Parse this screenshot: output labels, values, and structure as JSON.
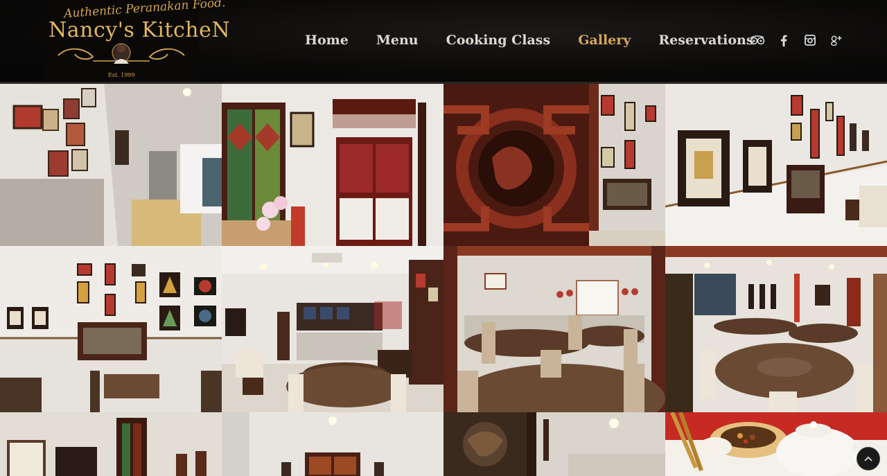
{
  "logo": {
    "tagline": "Authentic Peranakan Food.",
    "name": "Nancy's KitcheN",
    "established": "Est. 1999"
  },
  "nav": {
    "items": [
      {
        "label": "Home",
        "active": false
      },
      {
        "label": "Menu",
        "active": false
      },
      {
        "label": "Cooking Class",
        "active": false
      },
      {
        "label": "Gallery",
        "active": true
      },
      {
        "label": "Reservations",
        "active": false
      }
    ]
  },
  "social": [
    {
      "icon": "tripadvisor-icon"
    },
    {
      "icon": "facebook-icon"
    },
    {
      "icon": "instagram-icon"
    },
    {
      "icon": "google-plus-icon"
    }
  ],
  "gallery": {
    "photos": [
      {
        "subject": "photo-wall-entrance"
      },
      {
        "subject": "carved-doorway"
      },
      {
        "subject": "red-carved-panel-closeup"
      },
      {
        "subject": "portrait-wall"
      },
      {
        "subject": "framed-artwork-wall"
      },
      {
        "subject": "dining-room-counter"
      },
      {
        "subject": "dining-room-round-tables"
      },
      {
        "subject": "dining-room-lazy-susan"
      },
      {
        "subject": "newspaper-clipping-wall"
      },
      {
        "subject": "corridor-frames"
      },
      {
        "subject": "carved-wood-panel"
      },
      {
        "subject": "tea-set"
      }
    ]
  },
  "back_to_top": {
    "icon": "chevron-up-icon"
  }
}
